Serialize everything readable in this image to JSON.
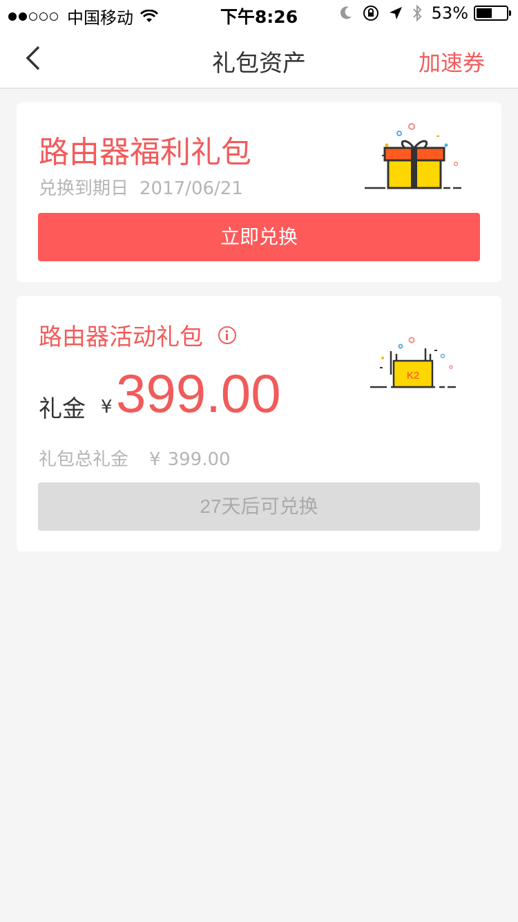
{
  "status_bar": {
    "carrier": "中国移动",
    "time": "下午8:26",
    "battery_percent": "53%",
    "battery_level": 0.53,
    "icons": [
      "wifi-icon",
      "moon-icon",
      "rotation-lock-icon",
      "location-icon",
      "bluetooth-icon",
      "battery-icon"
    ]
  },
  "nav": {
    "back_icon": "chevron-left-icon",
    "title": "礼包资产",
    "right_label": "加速券"
  },
  "welfare_card": {
    "title": "路由器福利礼包",
    "expiry_label": "兑换到期日",
    "expiry_date": "2017/06/21",
    "button_label": "立即兑换",
    "illustration": "gift-box-icon"
  },
  "activity_card": {
    "title": "路由器活动礼包",
    "info_icon": "info-icon",
    "illustration": "router-k2-icon",
    "router_model": "K2",
    "gift_money_label": "礼金",
    "currency": "¥",
    "gift_money_amount": "399.00",
    "total_label": "礼包总礼金",
    "total_currency": "¥",
    "total_amount": "399.00",
    "button_label": "27天后可兑换"
  },
  "colors": {
    "accent": "#f15b5b",
    "primary_button": "#fe5a59",
    "disabled_button": "#dcdcdc",
    "background": "#f5f5f5"
  }
}
